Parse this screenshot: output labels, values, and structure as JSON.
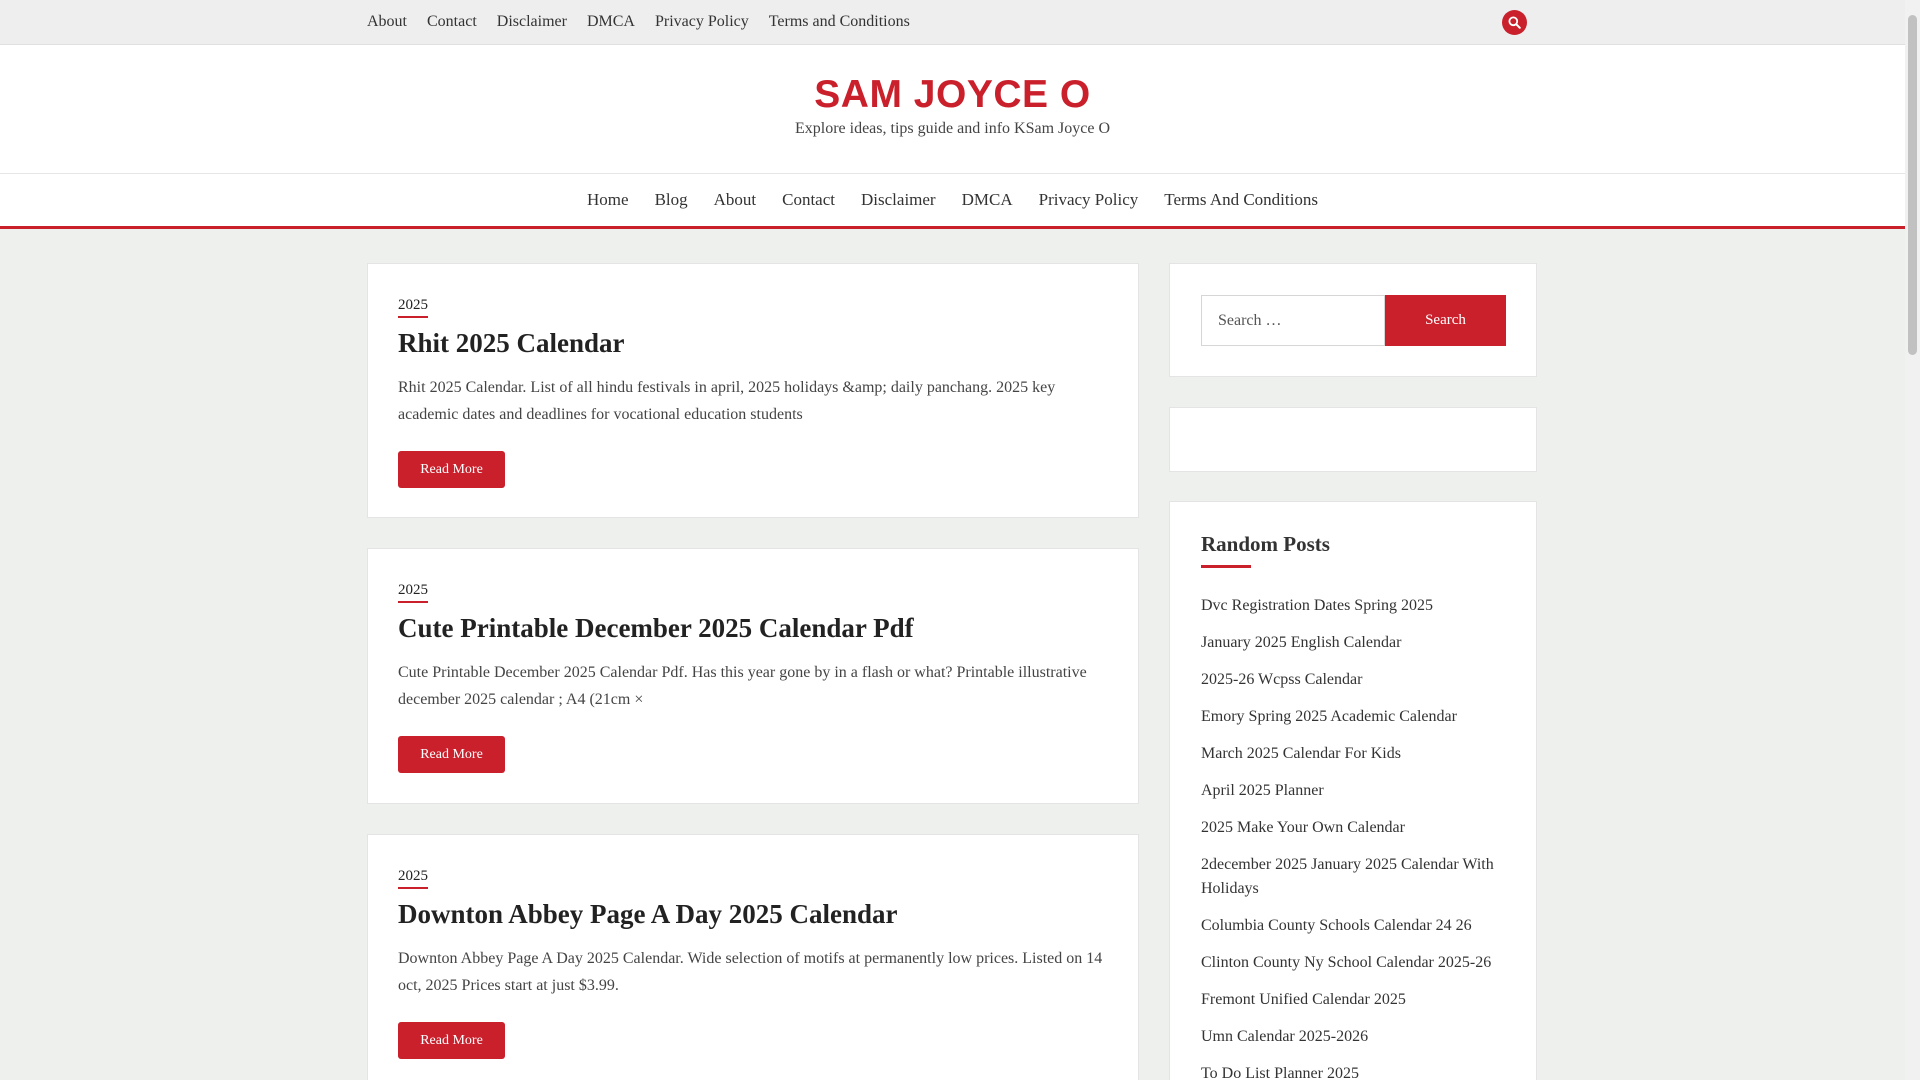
{
  "topbar": {
    "links": [
      "About",
      "Contact",
      "Disclaimer",
      "DMCA",
      "Privacy Policy",
      "Terms and Conditions"
    ],
    "search_icon": "search-icon"
  },
  "header": {
    "title": "SAM JOYCE O",
    "tagline": "Explore ideas, tips guide and info KSam Joyce O"
  },
  "mainnav": {
    "links": [
      "Home",
      "Blog",
      "About",
      "Contact",
      "Disclaimer",
      "DMCA",
      "Privacy Policy",
      "Terms And Conditions"
    ]
  },
  "posts": [
    {
      "category": "2025",
      "title": "Rhit 2025 Calendar",
      "excerpt": "Rhit 2025 Calendar. List of all hindu festivals in april, 2025 holidays &amp; daily panchang. 2025 key academic dates and deadlines for vocational education students",
      "read_more": "Read More"
    },
    {
      "category": "2025",
      "title": "Cute Printable December 2025 Calendar Pdf",
      "excerpt": "Cute Printable December 2025 Calendar Pdf. Has this year gone by in a flash or what? Printable illustrative december 2025 calendar ; A4 (21cm ×",
      "read_more": "Read More"
    },
    {
      "category": "2025",
      "title": "Downton Abbey Page A Day 2025 Calendar",
      "excerpt": "Downton Abbey Page A Day 2025 Calendar. Wide selection of motifs at permanently low prices. Listed on 14 oct, 2025 Prices start at just $3.99.",
      "read_more": "Read More"
    }
  ],
  "sidebar": {
    "search": {
      "placeholder": "Search …",
      "button": "Search"
    },
    "random_posts": {
      "title": "Random Posts",
      "items": [
        "Dvc Registration Dates Spring 2025",
        "January 2025 English Calendar",
        "2025-26 Wcpss Calendar",
        "Emory Spring 2025 Academic Calendar",
        "March 2025 Calendar For Kids",
        "April 2025 Planner",
        "2025 Make Your Own Calendar",
        "2december 2025 January 2025 Calendar With Holidays",
        "Columbia County Schools Calendar 24 26",
        "Clinton County Ny School Calendar 2025-26",
        "Fremont Unified Calendar 2025",
        "Umn Calendar 2025-2026",
        "To Do List Planner 2025"
      ]
    }
  },
  "colors": {
    "accent": "#c9202c",
    "page_bg": "#eef0ee"
  }
}
